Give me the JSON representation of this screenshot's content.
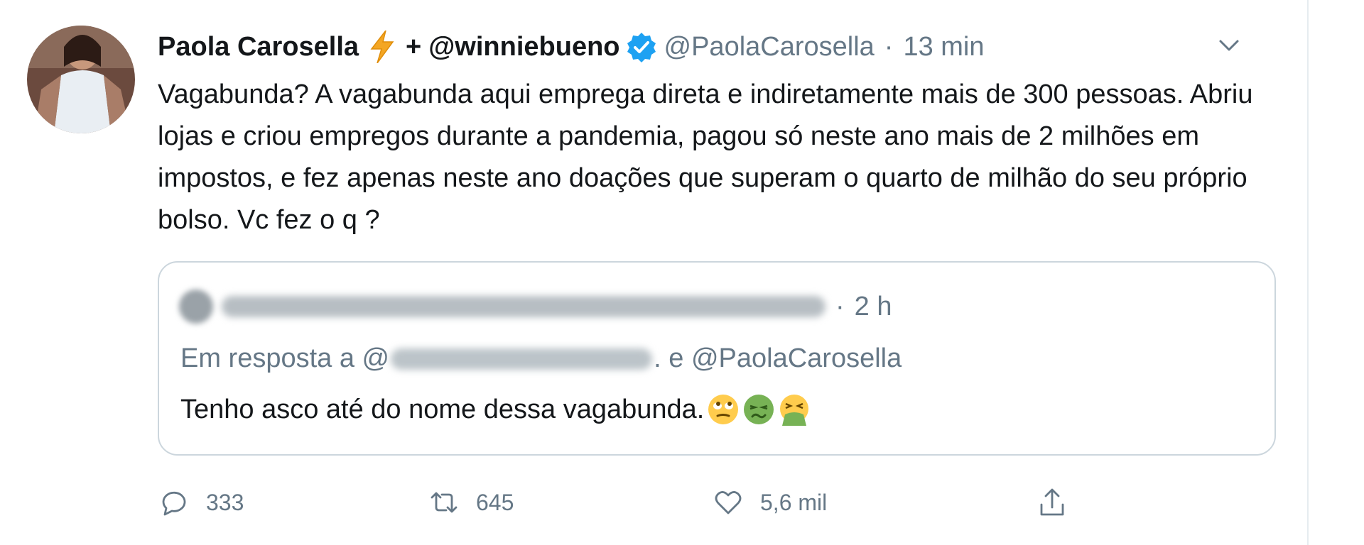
{
  "tweet": {
    "author_name": "Paola Carosella",
    "plus": "+",
    "coauthor": "@winniebueno",
    "handle": "@PaolaCarosella",
    "separator": "·",
    "time": "13 min",
    "text": "Vagabunda? A vagabunda aqui emprega direta e indiretamente mais de 300 pessoas. Abriu lojas e criou empregos durante a pandemia, pagou só neste ano mais de 2 milhões em impostos, e fez apenas neste ano doações que superam o quarto de milhão do seu próprio bolso. Vc fez o q ?"
  },
  "quote": {
    "separator": "·",
    "time": "2 h",
    "reply_prefix": "Em resposta a @",
    "reply_suffix": ". e @PaolaCarosella",
    "text": "Tenho asco até do nome dessa vagabunda."
  },
  "actions": {
    "reply_count": "333",
    "retweet_count": "645",
    "like_count": "5,6 mil"
  },
  "icons": {
    "bolt": "lightning-emoji",
    "verified": "verified-badge",
    "menu": "chevron-down-icon",
    "emoji_1": "rolling-eyes-emoji",
    "emoji_2": "nauseated-face-emoji",
    "emoji_3": "vomiting-face-emoji",
    "reply": "reply-icon",
    "retweet": "retweet-icon",
    "like": "heart-icon",
    "share": "share-icon"
  },
  "colors": {
    "text": "#14171a",
    "muted": "#657786",
    "verified_blue": "#1da1f2",
    "border": "#ccd6dd"
  }
}
